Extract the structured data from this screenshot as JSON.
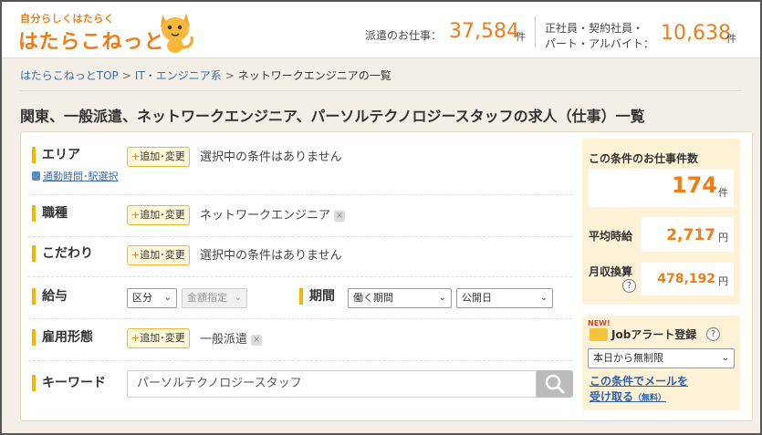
{
  "header": {
    "logo_tagline": "自分らしくはたらく",
    "logo_text": "はたらこねっと",
    "stat1_label": "派遣のお仕事：",
    "stat1_value": "37,584",
    "stat1_unit": "件",
    "stat2_label_line1": "正社員・契約社員・",
    "stat2_label_line2": "パート・アルバイト：",
    "stat2_value": "10,638",
    "stat2_unit": "件"
  },
  "breadcrumb": {
    "items": [
      "はたらこねっとTOP",
      "IT・エンジニア系",
      "ネットワークエンジニアの一覧"
    ],
    "separator": ">"
  },
  "page_title": "関東、一般派遣、ネットワークエンジニア、パーソルテクノロジースタッフの求人（仕事）一覧",
  "search": {
    "area": {
      "label": "エリア",
      "button": "追加･変更",
      "button_plus": "+",
      "value": "選択中の条件はありません",
      "sub_link": "通勤時間･駅選択"
    },
    "job_type": {
      "label": "職種",
      "button": "追加･変更",
      "button_plus": "+",
      "value": "ネットワークエンジニア"
    },
    "preference": {
      "label": "こだわり",
      "button": "追加･変更",
      "button_plus": "+",
      "value": "選択中の条件はありません"
    },
    "salary": {
      "label": "給与",
      "select1": "区分",
      "select2": "金額指定"
    },
    "period": {
      "label": "期間",
      "select1": "働く期間",
      "select2": "公開日"
    },
    "employment": {
      "label": "雇用形態",
      "button": "追加･変更",
      "button_plus": "+",
      "value": "一般派遣"
    },
    "keyword": {
      "label": "キーワード",
      "value": "パーソルテクノロジースタッフ"
    },
    "remove_mark": "×",
    "chevron": "⌄"
  },
  "info": {
    "title": "この条件のお仕事件数",
    "count": "174",
    "count_unit": "件",
    "avg_label": "平均時給",
    "avg_value": "2,717",
    "avg_unit": "円",
    "monthly_label": "月収換算",
    "monthly_value": "478,192",
    "monthly_unit": "円",
    "help": "?"
  },
  "alert": {
    "new_badge": "NEW!",
    "title": "Jobアラート登録",
    "help": "?",
    "select_value": "本日から無制限",
    "link_line1": "この条件でメールを",
    "link_line2": "受け取る",
    "link_free": "（無料）"
  },
  "colors": {
    "accent_orange": "#ef7d16",
    "label_bar_yellow": "#f4b400",
    "link_blue": "#3a6ea8",
    "info_bg": "#fdf1d6"
  }
}
